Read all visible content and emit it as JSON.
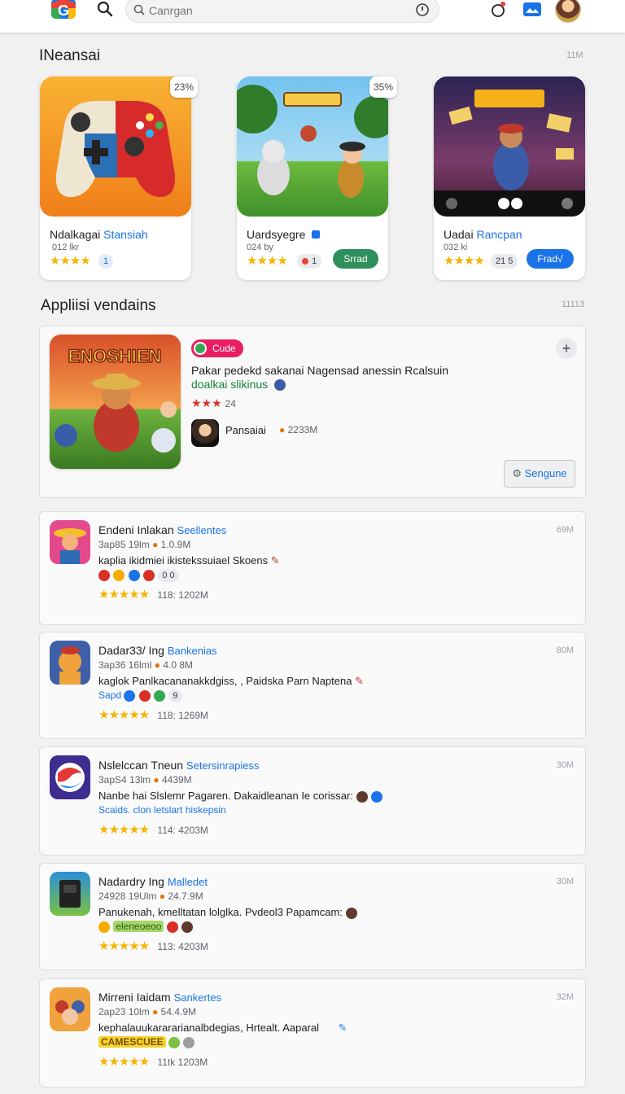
{
  "search": {
    "placeholder": "Canrgan"
  },
  "colors": {
    "accent": "#1a73e8",
    "star": "#f5b400",
    "green": "#188038",
    "badge_pink": "#e91e63"
  },
  "section1": {
    "title": "INeansai",
    "meta": "11M"
  },
  "featured": [
    {
      "badge": "23%",
      "title": "Ndalkagai",
      "accent": "Stansiah",
      "sub": " 012 lkr",
      "rating": "★★★★",
      "chip": "1"
    },
    {
      "badge": "35%",
      "title": "Uardsyegre",
      "accent": "",
      "sub": "024 by",
      "rating": "★★★★",
      "chip": "1",
      "button": "Srrad"
    },
    {
      "badge": "",
      "title": "Uadai",
      "accent": "Rancpan",
      "sub": "032 ki",
      "rating": "★★★★",
      "chip": "21 5",
      "button": "Frad√"
    }
  ],
  "section2": {
    "title": "Appliisi vendains",
    "meta": "11113"
  },
  "promo": {
    "tag": "Cude",
    "line1": "Pakar pedekd sakanai Nagensad anessin Rcalsuin",
    "line2": "doalkai slikinus",
    "rating": "★★★",
    "rating_count": "24",
    "dev": "Pansaiai",
    "size": "2233M",
    "button": "Sengune",
    "art_title": "ENOSHIEN"
  },
  "list": [
    {
      "title": "Endeni Inlakan",
      "accent": "Seellentes",
      "meta_a": "3ap85 19lm",
      "meta_b": "1.0.9M",
      "desc": "kaplia ikidmiei ikistekssuiael Skoens",
      "tag_text": "0 0",
      "rating": "★★★★★",
      "rating_text": "118: 1202M",
      "size": "69M"
    },
    {
      "title": "Dadar33/ Ing",
      "accent": "Bankenias",
      "meta_a": "3ap36 16lml",
      "meta_b": "4.0 8M",
      "desc": "kaglok Panlkacananakkdgiss, , Paidska Parn Naptena",
      "tag_text": "Sapd",
      "tag_chip": "9",
      "rating": "★★★★★",
      "rating_text": "118: 1269M",
      "size": "80M"
    },
    {
      "title": "Nslelccan Tneun",
      "accent": "Setersinrapiess",
      "meta_a": "3apS4 13lm",
      "meta_b": "4439M",
      "desc": "Nanbe hai Slslemr Pagaren. Dakaidleanan Ie corissar:",
      "tag_text": "Scaids. clon letslart hiskepsin",
      "rating": "★★★★★",
      "rating_text": "114: 4203M",
      "size": "30M"
    },
    {
      "title": "Nadardry Ing",
      "accent": "Malledet",
      "meta_a": "24928 19Ulm",
      "meta_b": "24.7.9M",
      "desc": "Panukenah, kmelltatan lolglka. Pvdeol3 Papamcam:",
      "tag_text": "eleneoeoo",
      "rating": "★★★★★",
      "rating_text": "113: 4203M",
      "size": "30M"
    },
    {
      "title": "Mirreni Iaidam",
      "accent": "Sankertes",
      "meta_a": "2ap23 10lm",
      "meta_b": "54.4.9M",
      "desc": "kephalauukarararianalbdegias, Hrtealt. Aaparal",
      "tag_text": "CAMESCUEE",
      "rating": "★★★★★",
      "rating_text": "11tk 1203M",
      "size": "32M"
    }
  ]
}
